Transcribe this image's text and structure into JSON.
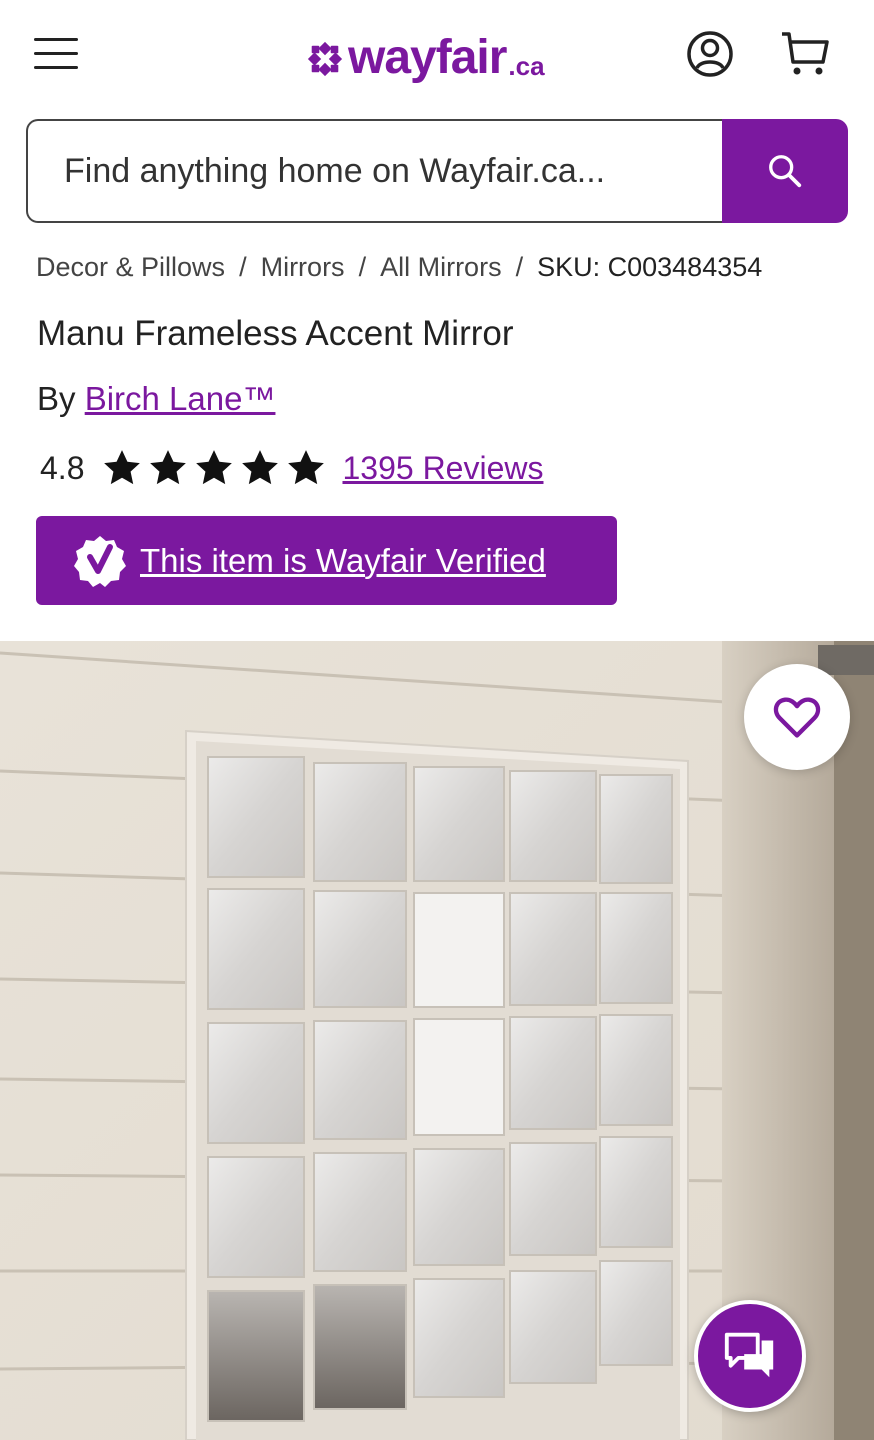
{
  "header": {
    "menu_icon": "hamburger-menu-icon",
    "logo": {
      "word": "wayfair",
      "tld": ".ca"
    },
    "account_icon": "account-icon",
    "cart_icon": "cart-icon"
  },
  "search": {
    "placeholder": "Find anything home on Wayfair.ca...",
    "value": "",
    "button_icon": "search-icon"
  },
  "breadcrumb": {
    "items": [
      "Decor & Pillows",
      "Mirrors",
      "All Mirrors"
    ],
    "separator": "/",
    "sku": "SKU: C003484354"
  },
  "product": {
    "title": "Manu Frameless Accent Mirror",
    "by_prefix": "By",
    "brand": "Birch Lane™",
    "rating_value": "4.8",
    "star_count": 5,
    "reviews_label": "1395 Reviews",
    "verified_label": "This item is Wayfair Verified"
  },
  "image": {
    "favorite_icon": "heart-icon",
    "chat_icon": "chat-icon"
  },
  "colors": {
    "brand_purple": "#7b189f",
    "text": "#222222"
  }
}
